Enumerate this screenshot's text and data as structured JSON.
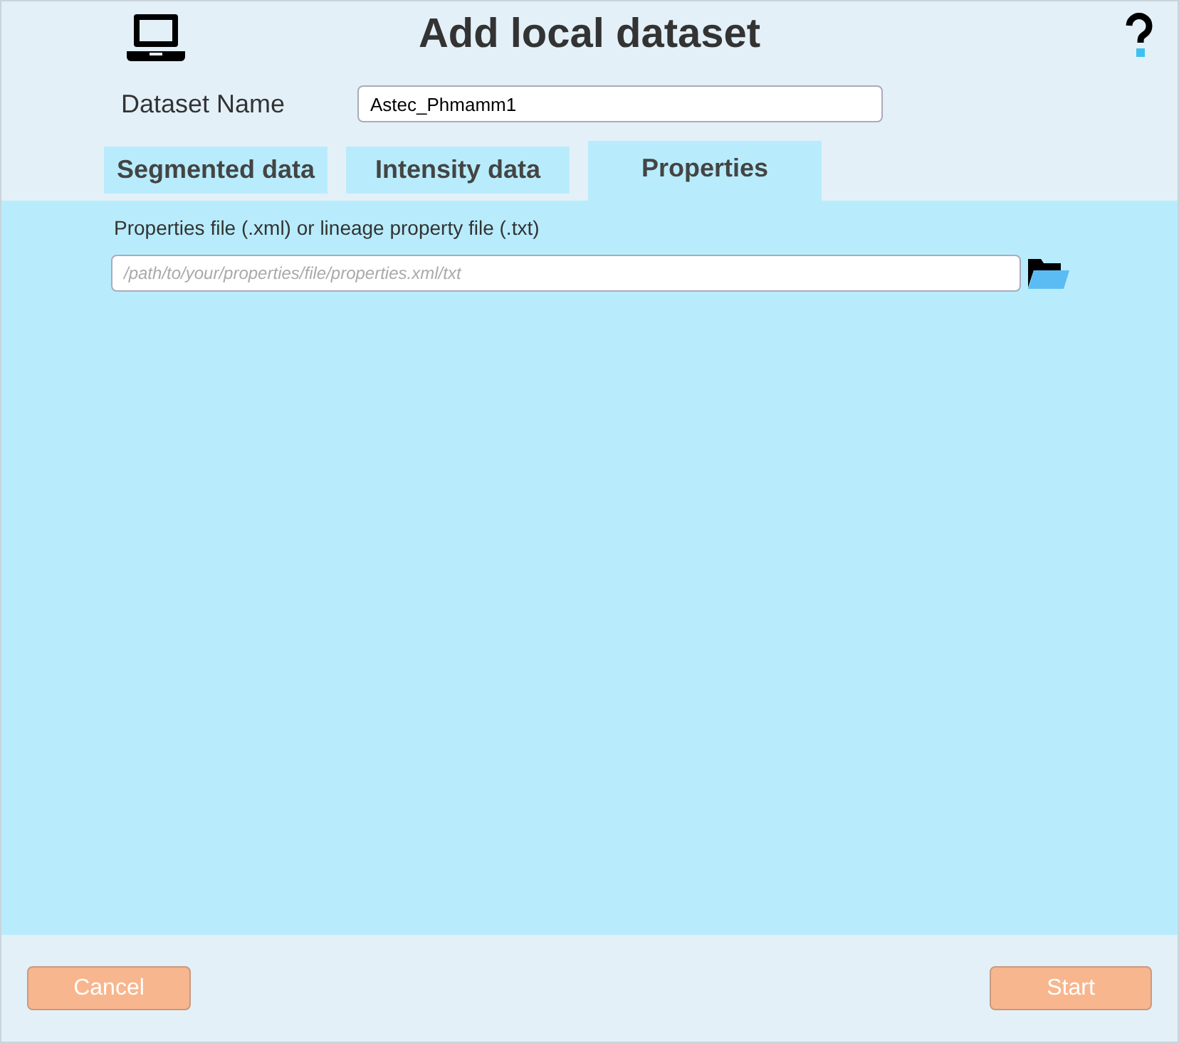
{
  "window": {
    "title": "Add local dataset"
  },
  "dataset_name": {
    "label": "Dataset Name",
    "value": "Astec_Phmamm1"
  },
  "tabs": [
    {
      "label": "Segmented data",
      "selected": false
    },
    {
      "label": "Intensity data",
      "selected": false
    },
    {
      "label": "Properties",
      "selected": true
    }
  ],
  "properties": {
    "label": "Properties file (.xml) or lineage property file (.txt)",
    "placeholder": "/path/to/your/properties/file/properties.xml/txt"
  },
  "buttons": [
    {
      "label": "Cancel"
    },
    {
      "label": "Start"
    }
  ]
}
